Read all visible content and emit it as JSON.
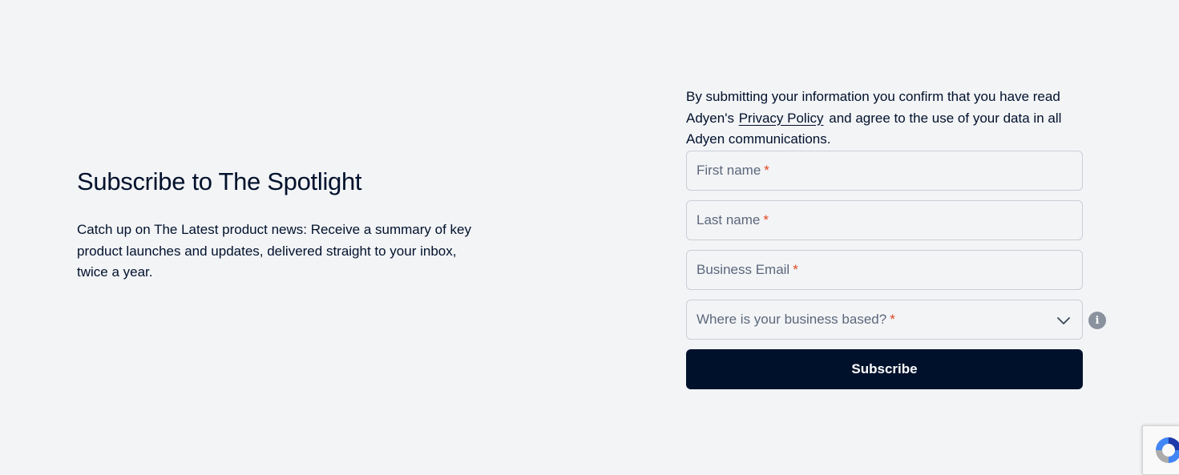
{
  "intro": {
    "title": "Subscribe to The Spotlight",
    "description": "Catch up on The Latest product news: Receive a summary of key product launches and updates, delivered straight to your inbox, twice a year."
  },
  "form": {
    "consent_before": "By submitting your information you confirm that you have read Adyen's",
    "privacy_link": "Privacy Policy",
    "consent_after": "and agree to the use of your data in all Adyen communications.",
    "fields": {
      "first_name": {
        "placeholder": "First name",
        "required_mark": "*"
      },
      "last_name": {
        "placeholder": "Last name",
        "required_mark": "*"
      },
      "business_email": {
        "placeholder": "Business Email",
        "required_mark": "*"
      },
      "country": {
        "placeholder": "Where is your business based?",
        "required_mark": "*"
      }
    },
    "info_icon": "i",
    "submit_label": "Subscribe"
  },
  "icons": {
    "dropdown": "chevron-down-icon",
    "info": "info-icon",
    "recaptcha": "recaptcha-logo-icon"
  },
  "colors": {
    "background": "#f3f4f6",
    "text": "#00112c",
    "required": "#e0461f",
    "button": "#00112c"
  }
}
